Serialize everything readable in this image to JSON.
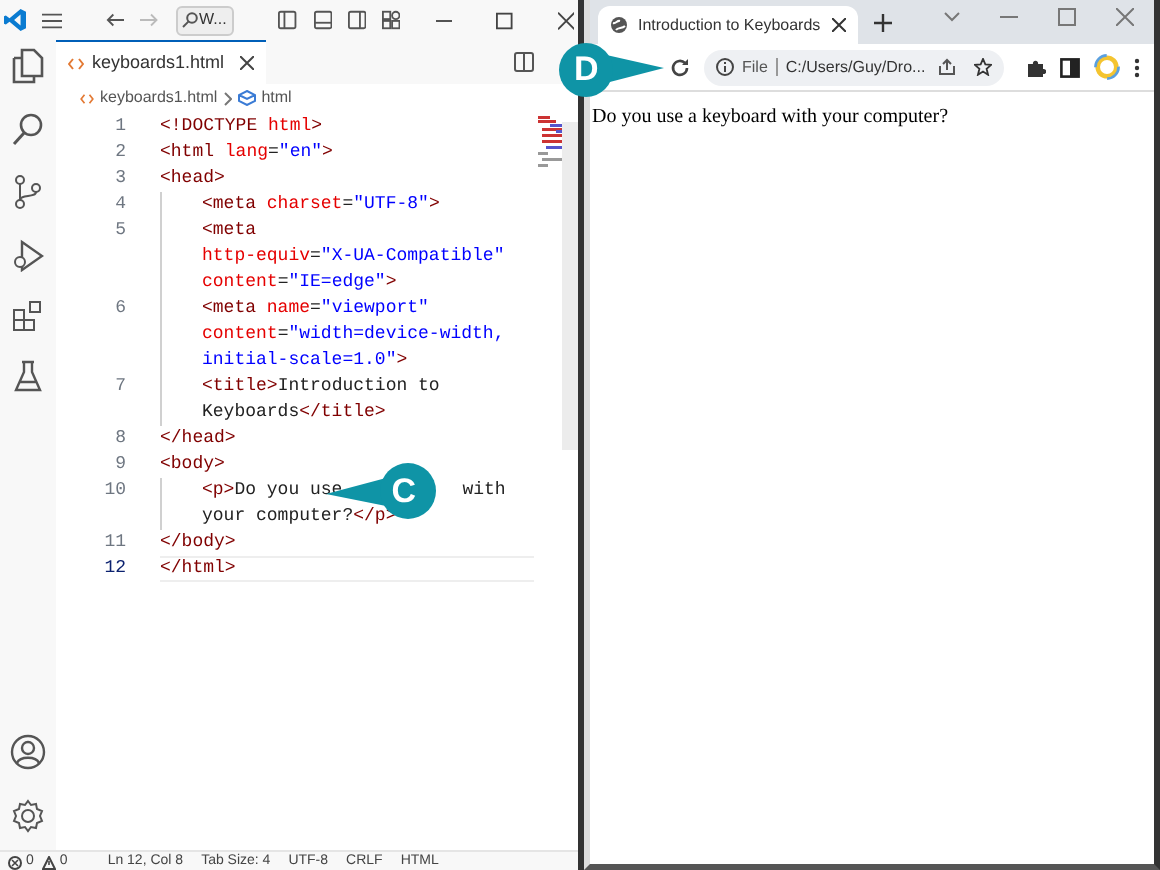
{
  "editor": {
    "title_bar": {
      "search": "W..."
    },
    "tab": {
      "label": "keyboards1.html",
      "selected": true
    },
    "breadcrumb": [
      "keyboards1.html",
      "html"
    ],
    "lines": [
      {
        "number": "1",
        "current": false,
        "indented": false,
        "rows": [
          {
            "tokens": [
              {
                "text": "<!DOCTYPE ",
                "kind": "tag"
              },
              {
                "text": "html",
                "kind": "attr"
              },
              {
                "text": ">",
                "kind": "tag"
              }
            ]
          }
        ]
      },
      {
        "number": "2",
        "current": false,
        "indented": false,
        "rows": [
          {
            "tokens": [
              {
                "text": "<html ",
                "kind": "tag"
              },
              {
                "text": "lang",
                "kind": "attr"
              },
              {
                "text": "=",
                "kind": "plain"
              },
              {
                "text": "\"en\"",
                "kind": "value"
              },
              {
                "text": ">",
                "kind": "tag"
              }
            ]
          }
        ]
      },
      {
        "number": "3",
        "current": false,
        "indented": false,
        "rows": [
          {
            "tokens": [
              {
                "text": "<head>",
                "kind": "tag"
              }
            ]
          }
        ]
      },
      {
        "number": "4",
        "current": false,
        "indented": true,
        "rows": [
          {
            "tokens": [
              {
                "text": "<meta ",
                "kind": "tag"
              },
              {
                "text": "charset",
                "kind": "attr"
              },
              {
                "text": "=",
                "kind": "plain"
              },
              {
                "text": "\"UTF-8\"",
                "kind": "value"
              },
              {
                "text": ">",
                "kind": "tag"
              }
            ]
          }
        ]
      },
      {
        "number": "5",
        "current": false,
        "indented": true,
        "rows": [
          {
            "tokens": [
              {
                "text": "<meta",
                "kind": "tag"
              }
            ]
          },
          {
            "tokens": [
              {
                "text": "http-equiv",
                "kind": "attr"
              },
              {
                "text": "=",
                "kind": "plain"
              },
              {
                "text": "\"X-UA-Compatible\"",
                "kind": "value"
              }
            ]
          },
          {
            "tokens": [
              {
                "text": "content",
                "kind": "attr"
              },
              {
                "text": "=",
                "kind": "plain"
              },
              {
                "text": "\"IE=edge\"",
                "kind": "value"
              },
              {
                "text": ">",
                "kind": "tag"
              }
            ]
          }
        ]
      },
      {
        "number": "6",
        "current": false,
        "indented": true,
        "rows": [
          {
            "tokens": [
              {
                "text": "<meta ",
                "kind": "tag"
              },
              {
                "text": "name",
                "kind": "attr"
              },
              {
                "text": "=",
                "kind": "plain"
              },
              {
                "text": "\"viewport\"",
                "kind": "value"
              }
            ]
          },
          {
            "tokens": [
              {
                "text": "content",
                "kind": "attr"
              },
              {
                "text": "=",
                "kind": "plain"
              },
              {
                "text": "\"width=device-width,",
                "kind": "value"
              }
            ]
          },
          {
            "tokens": [
              {
                "text": "initial-scale=1.0\"",
                "kind": "value"
              },
              {
                "text": ">",
                "kind": "tag"
              }
            ]
          }
        ]
      },
      {
        "number": "7",
        "current": false,
        "indented": true,
        "rows": [
          {
            "tokens": [
              {
                "text": "<title>",
                "kind": "tag"
              },
              {
                "text": "Introduction to",
                "kind": "plain"
              }
            ]
          },
          {
            "tokens": [
              {
                "text": "Keyboards",
                "kind": "plain"
              },
              {
                "text": "</title>",
                "kind": "tag"
              }
            ]
          }
        ]
      },
      {
        "number": "8",
        "current": false,
        "indented": false,
        "rows": [
          {
            "tokens": [
              {
                "text": "</head>",
                "kind": "tag"
              }
            ]
          }
        ]
      },
      {
        "number": "9",
        "current": false,
        "indented": false,
        "rows": [
          {
            "tokens": [
              {
                "text": "<body>",
                "kind": "tag"
              }
            ]
          }
        ]
      },
      {
        "number": "10",
        "current": false,
        "indented": true,
        "rows": [
          {
            "tokens": [
              {
                "text": "<p>",
                "kind": "tag"
              },
              {
                "text": "Do you use",
                "kind": "plain"
              },
              {
                "text": "with",
                "kind": "after_callout"
              }
            ]
          },
          {
            "tokens": [
              {
                "text": "your computer?",
                "kind": "plain"
              },
              {
                "text": "</p>",
                "kind": "tag"
              }
            ]
          }
        ]
      },
      {
        "number": "11",
        "current": false,
        "indented": false,
        "rows": [
          {
            "tokens": [
              {
                "text": "</body>",
                "kind": "tag"
              }
            ]
          }
        ]
      },
      {
        "number": "12",
        "current": true,
        "indented": false,
        "rows": [
          {
            "tokens": [
              {
                "text": "</html>",
                "kind": "tag"
              }
            ]
          }
        ]
      }
    ],
    "status_bar": {
      "errors": "0",
      "warnings": "0",
      "items": [
        "Ln 12, Col 8",
        "Tab Size: 4",
        "UTF-8",
        "CRLF",
        "HTML"
      ]
    }
  },
  "browser": {
    "tab": {
      "title": "Introduction to Keyboards",
      "selected": true
    },
    "address_bar": {
      "scheme": "File",
      "url": "C:/Users/Guy/Dro..."
    },
    "page_text": "Do you use a keyboard with your computer?"
  },
  "callouts": [
    {
      "label": "C"
    },
    {
      "label": "D"
    }
  ]
}
